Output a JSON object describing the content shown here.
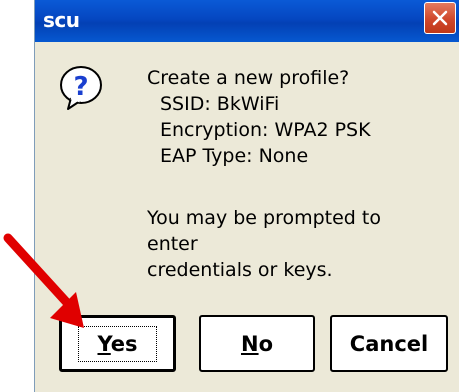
{
  "dialog": {
    "title": "scu",
    "message_lines": [
      "Create a new profile?",
      "SSID: BkWiFi",
      "Encryption: WPA2 PSK",
      "EAP Type: None"
    ],
    "note_lines": [
      "You may be prompted to",
      "enter",
      "credentials or keys."
    ]
  },
  "buttons": {
    "yes_mnemonic": "Y",
    "yes_rest": "es",
    "no_mnemonic": "N",
    "no_rest": "o",
    "cancel_label": "Cancel"
  },
  "icons": {
    "dialog_icon": "question-icon",
    "close_icon": "close-icon",
    "annotation": "red-arrow"
  },
  "colors": {
    "titlebar": "#0a5ad6",
    "close_button": "#d0472b",
    "dialog_background": "#ece9d8",
    "annotation_arrow": "#e00000"
  }
}
